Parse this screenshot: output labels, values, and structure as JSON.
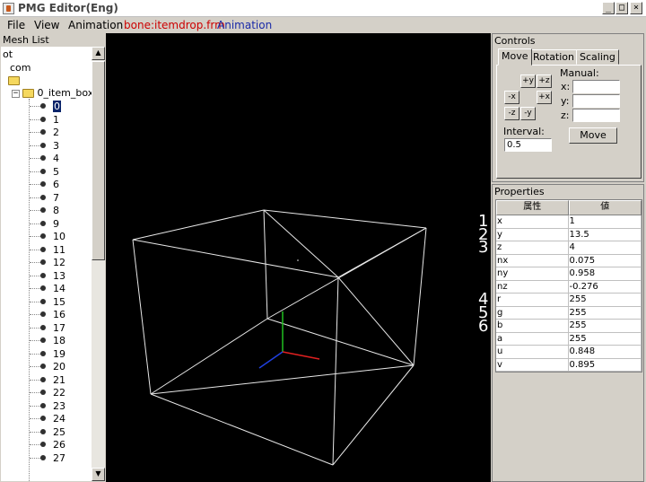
{
  "window": {
    "title": "PMG Editor(Eng)",
    "min": "_",
    "max": "□",
    "close": "×"
  },
  "menu": {
    "file": "File",
    "view": "View",
    "animation": "Animation",
    "bone_file": "bone:itemdrop.frm",
    "animation2": "Animation"
  },
  "mesh_list": {
    "title": "Mesh List",
    "root_partial": "ot",
    "com": "com",
    "item_box": "0_item_box",
    "items": [
      "0",
      "1",
      "2",
      "3",
      "4",
      "5",
      "6",
      "7",
      "8",
      "9",
      "10",
      "11",
      "12",
      "13",
      "14",
      "15",
      "16",
      "17",
      "18",
      "19",
      "20",
      "21",
      "22",
      "23",
      "24",
      "25",
      "26",
      "27"
    ],
    "selected": "0"
  },
  "controls": {
    "title": "Controls",
    "tabs": [
      "Move",
      "Rotation",
      "Scaling"
    ],
    "manual_label": "Manual:",
    "buttons": {
      "py": "+y",
      "pz": "+z",
      "nx": "-x",
      "px": "+x",
      "nz": "-z",
      "ny": "-y"
    },
    "x_label": "x:",
    "y_label": "y:",
    "z_label": "z:",
    "x_value": "",
    "y_value": "",
    "z_value": "",
    "interval_label": "Interval:",
    "interval_value": "0.5",
    "move_button": "Move"
  },
  "properties": {
    "title": "Properties",
    "headers": [
      "属性",
      "値"
    ],
    "rows": [
      {
        "k": "x",
        "v": "1"
      },
      {
        "k": "y",
        "v": "13.5"
      },
      {
        "k": "z",
        "v": "4"
      },
      {
        "k": "nx",
        "v": "0.075"
      },
      {
        "k": "ny",
        "v": "0.958"
      },
      {
        "k": "nz",
        "v": "-0.276"
      },
      {
        "k": "r",
        "v": "255"
      },
      {
        "k": "g",
        "v": "255"
      },
      {
        "k": "b",
        "v": "255"
      },
      {
        "k": "a",
        "v": "255"
      },
      {
        "k": "u",
        "v": "0.848"
      },
      {
        "k": "v",
        "v": "0.895"
      }
    ]
  },
  "annotations": [
    "1",
    "2",
    "3",
    "4",
    "5",
    "6"
  ],
  "colors": {
    "viewport_bg": "#000000",
    "wire": "#e8e8e8",
    "axis_x": "#e02020",
    "axis_y": "#20c020",
    "axis_z": "#2040e0"
  }
}
